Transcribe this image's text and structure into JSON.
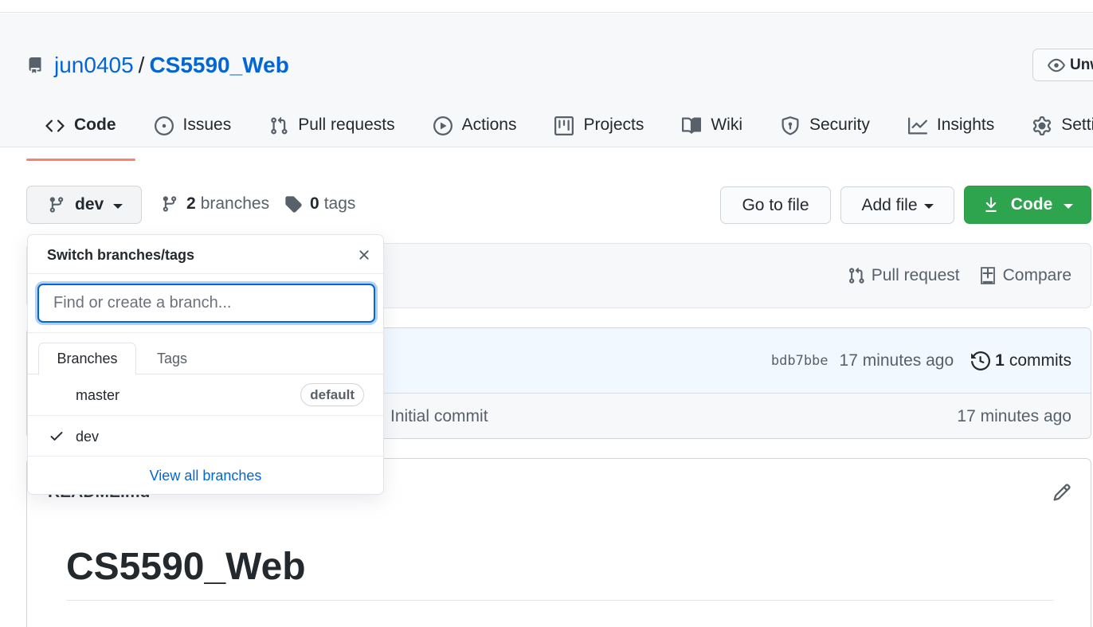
{
  "repo": {
    "owner": "jun0405",
    "separator": "/",
    "name": "CS5590_Web",
    "watch_label": "Unw"
  },
  "tabs": [
    {
      "label": "Code",
      "icon": "code-icon",
      "selected": true
    },
    {
      "label": "Issues",
      "icon": "issue-icon"
    },
    {
      "label": "Pull requests",
      "icon": "pull-request-icon"
    },
    {
      "label": "Actions",
      "icon": "play-icon"
    },
    {
      "label": "Projects",
      "icon": "project-icon"
    },
    {
      "label": "Wiki",
      "icon": "book-icon"
    },
    {
      "label": "Security",
      "icon": "shield-icon"
    },
    {
      "label": "Insights",
      "icon": "graph-icon"
    },
    {
      "label": "Settings",
      "icon": "gear-icon"
    }
  ],
  "toolbar": {
    "branch_label": "dev",
    "branches_count": "2",
    "branches_label": "branches",
    "tags_count": "0",
    "tags_label": "tags",
    "go_to_file": "Go to file",
    "add_file": "Add file",
    "code": "Code"
  },
  "compare_bar": {
    "pull_request": "Pull request",
    "compare": "Compare"
  },
  "commit": {
    "sha": "bdb7bbe",
    "age": "17 minutes ago",
    "count": "1",
    "count_label": "commits"
  },
  "file_row": {
    "message": "Initial commit",
    "age": "17 minutes ago"
  },
  "readme": {
    "filename": "README.md",
    "heading": "CS5590_Web"
  },
  "branch_dropdown": {
    "title": "Switch branches/tags",
    "placeholder": "Find or create a branch...",
    "tabs": [
      "Branches",
      "Tags"
    ],
    "items": [
      {
        "name": "master",
        "badge": "default",
        "checked": false
      },
      {
        "name": "dev",
        "checked": true
      }
    ],
    "footer": "View all branches"
  },
  "colors": {
    "link": "#0366d6",
    "primary_button": "#2ea44f",
    "selected_tab_underline": "#f9826c",
    "header_bg": "#f6f8fa"
  }
}
